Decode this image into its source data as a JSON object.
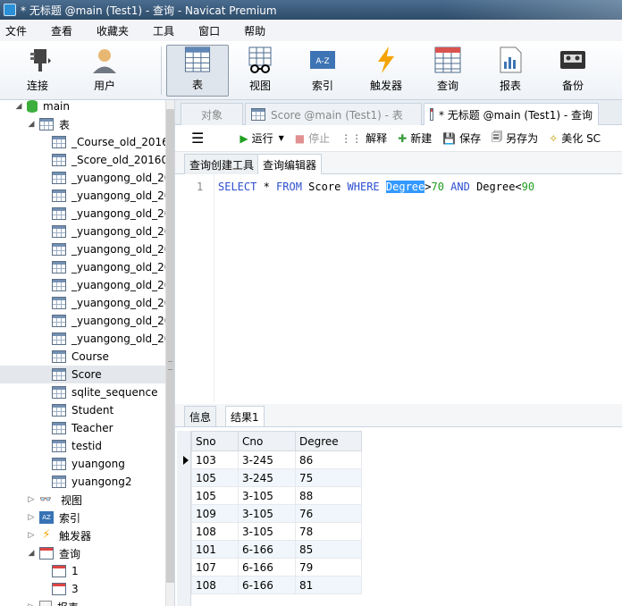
{
  "window": {
    "title": "* 无标题 @main (Test1) - 查询 - Navicat Premium"
  },
  "menubar": [
    "文件",
    "查看",
    "收藏夹",
    "工具",
    "窗口",
    "帮助"
  ],
  "toolbar": {
    "items": [
      {
        "label": "连接",
        "icon": "plug-icon"
      },
      {
        "label": "用户",
        "icon": "user-icon"
      },
      {
        "label": "表",
        "icon": "table-icon",
        "active": true
      },
      {
        "label": "视图",
        "icon": "view-icon"
      },
      {
        "label": "索引",
        "icon": "index-icon"
      },
      {
        "label": "触发器",
        "icon": "trigger-icon"
      },
      {
        "label": "查询",
        "icon": "query-icon"
      },
      {
        "label": "报表",
        "icon": "report-icon"
      },
      {
        "label": "备份",
        "icon": "backup-icon"
      }
    ]
  },
  "sidebar": {
    "db": "main",
    "tables_label": "表",
    "tables": [
      "_Course_old_2016",
      "_Score_old_20160",
      "_yuangong_old_20",
      "_yuangong_old_20",
      "_yuangong_old_20",
      "_yuangong_old_20",
      "_yuangong_old_20",
      "_yuangong_old_20",
      "_yuangong_old_20",
      "_yuangong_old_20",
      "_yuangong_old_20",
      "_yuangong_old_20",
      "Course",
      "Score",
      "sqlite_sequence",
      "Student",
      "Teacher",
      "testid",
      "yuangong",
      "yuangong2"
    ],
    "selected_table": "Score",
    "views_label": "视图",
    "indexes_label": "索引",
    "triggers_label": "触发器",
    "queries_label": "查询",
    "queries": [
      "1",
      "3"
    ],
    "reports_label": "报表"
  },
  "tabs": [
    {
      "label": "对象"
    },
    {
      "label": "Score @main (Test1) - 表"
    },
    {
      "label": "* 无标题 @main (Test1) - 查询",
      "active": true
    }
  ],
  "query_toolbar": {
    "run": "运行",
    "stop": "停止",
    "explain": "解释",
    "new": "新建",
    "save": "保存",
    "save_as": "另存为",
    "beautify": "美化 SC"
  },
  "subtabs": [
    "查询创建工具",
    "查询编辑器"
  ],
  "editor": {
    "line_number": "1",
    "tokens": [
      {
        "t": "SELECT",
        "c": "kw"
      },
      {
        "t": " * ",
        "c": ""
      },
      {
        "t": "FROM",
        "c": "kw"
      },
      {
        "t": " Score ",
        "c": ""
      },
      {
        "t": "WHERE",
        "c": "kw"
      },
      {
        "t": " ",
        "c": ""
      },
      {
        "t": "Degree",
        "c": "hl"
      },
      {
        "t": ">",
        "c": ""
      },
      {
        "t": "70",
        "c": "num"
      },
      {
        "t": " ",
        "c": ""
      },
      {
        "t": "AND",
        "c": "kw"
      },
      {
        "t": " Degree<",
        "c": ""
      },
      {
        "t": "90",
        "c": "num"
      }
    ]
  },
  "result_tabs": [
    "信息",
    "结果1"
  ],
  "results": {
    "columns": [
      "Sno",
      "Cno",
      "Degree"
    ],
    "rows": [
      [
        "103",
        "3-245",
        "86"
      ],
      [
        "105",
        "3-245",
        "75"
      ],
      [
        "105",
        "3-105",
        "88"
      ],
      [
        "109",
        "3-105",
        "76"
      ],
      [
        "108",
        "3-105",
        "78"
      ],
      [
        "101",
        "6-166",
        "85"
      ],
      [
        "107",
        "6-166",
        "79"
      ],
      [
        "108",
        "6-166",
        "81"
      ]
    ]
  }
}
